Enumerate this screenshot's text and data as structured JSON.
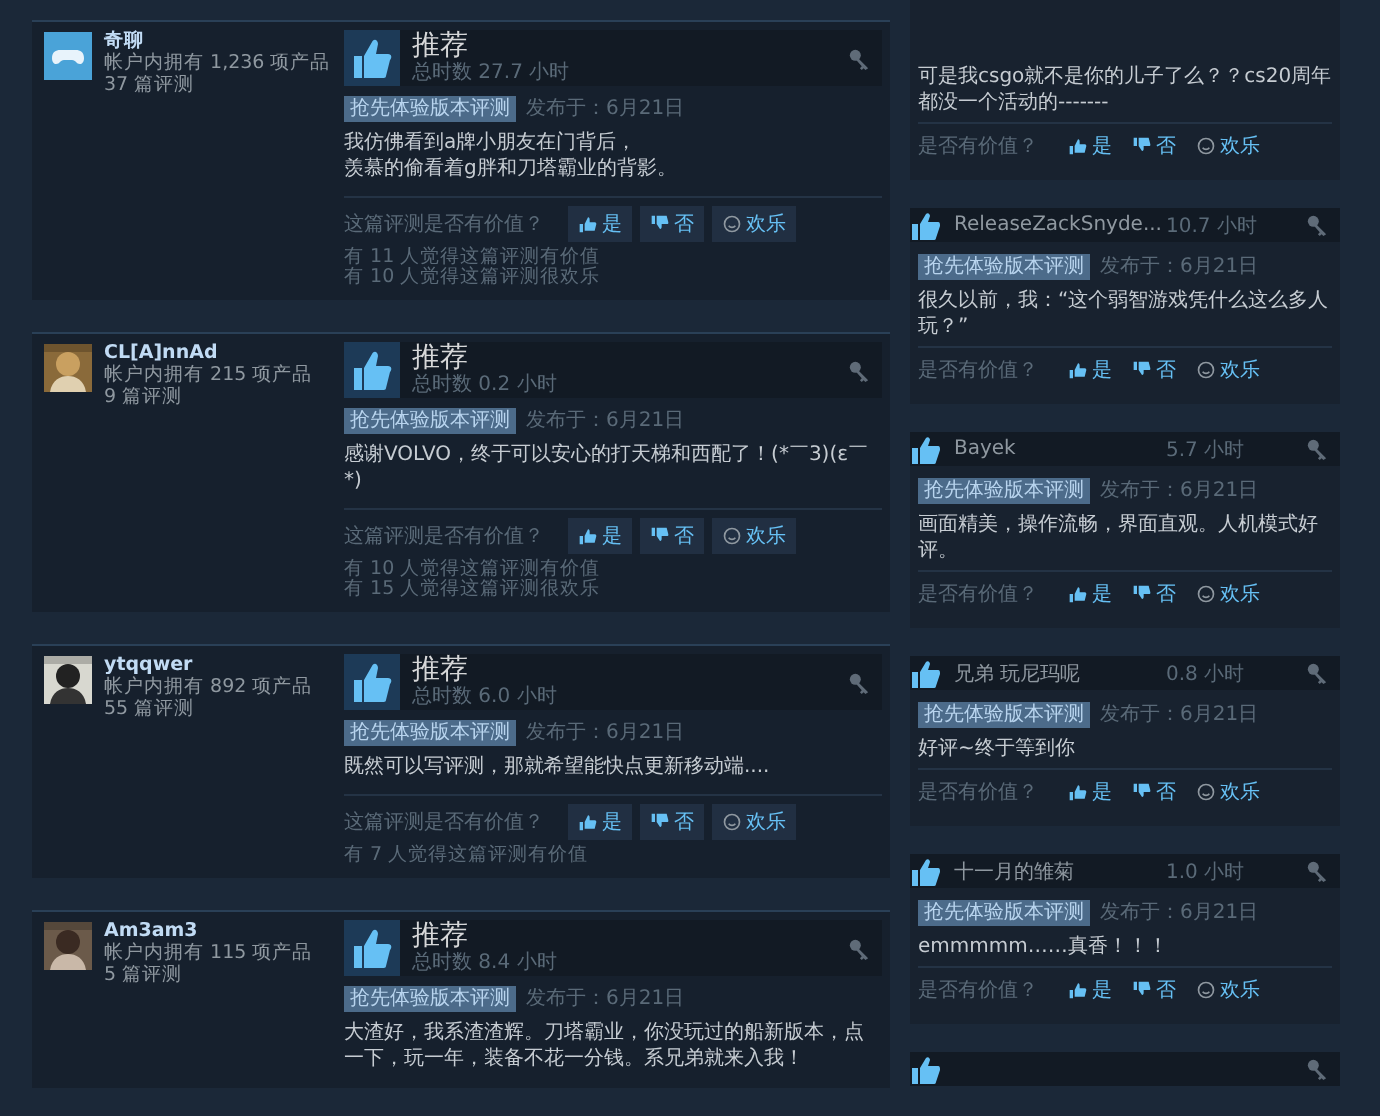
{
  "reviews": [
    {
      "author": "奇聊",
      "owned": "帐户内拥有 1,236 项产品",
      "review_count": "37 篇评测",
      "avatar": {
        "kind": "gamepad"
      },
      "verdict": "推荐",
      "hours": "总时数 27.7 小时",
      "tag": "抢先体验版本评测",
      "posted": "发布于：6月21日",
      "text": [
        "我仿佛看到a牌小朋友在门背后，",
        "羡慕的偷看着g胖和刀塔霸业的背影。"
      ],
      "question": "这篇评测是否有价值？",
      "buttons": [
        "是",
        "否",
        "欢乐"
      ],
      "counts": [
        "有 11 人觉得这篇评测有价值",
        "有 10 人觉得这篇评测很欢乐"
      ]
    },
    {
      "author": "CL[A]nnAd",
      "owned": "帐户内拥有 215 项产品",
      "review_count": "9 篇评测",
      "avatar": {
        "kind": "picture"
      },
      "verdict": "推荐",
      "hours": "总时数 0.2 小时",
      "tag": "抢先体验版本评测",
      "posted": "发布于：6月21日",
      "text": [
        "感谢VOLVO，终于可以安心的打天梯和西配了！(*￣3)(ε￣*)"
      ],
      "question": "这篇评测是否有价值？",
      "buttons": [
        "是",
        "否",
        "欢乐"
      ],
      "counts": [
        "有 10 人觉得这篇评测有价值",
        "有 15 人觉得这篇评测很欢乐"
      ]
    },
    {
      "author": "ytqqwer",
      "owned": "帐户内拥有 892 项产品",
      "review_count": "55 篇评测",
      "avatar": {
        "kind": "picture"
      },
      "verdict": "推荐",
      "hours": "总时数 6.0 小时",
      "tag": "抢先体验版本评测",
      "posted": "发布于：6月21日",
      "text": [
        "既然可以写评测，那就希望能快点更新移动端...."
      ],
      "question": "这篇评测是否有价值？",
      "buttons": [
        "是",
        "否",
        "欢乐"
      ],
      "counts": [
        "有 7 人觉得这篇评测有价值"
      ]
    },
    {
      "author": "Am3am3",
      "owned": "帐户内拥有 115 项产品",
      "review_count": "5 篇评测",
      "avatar": {
        "kind": "picture"
      },
      "verdict": "推荐",
      "hours": "总时数 8.4 小时",
      "tag": "抢先体验版本评测",
      "posted": "发布于：6月21日",
      "text": [
        "大渣好，我系渣渣辉。刀塔霸业，你没玩过的船新版本，点一下，玩一年，装备不花一分钱。系兄弟就来入我！"
      ]
    }
  ],
  "side_reviews": [
    {
      "kind": "continued",
      "text": "可是我csgo就不是你的儿子了么？？cs20周年都没一个活动的-------",
      "question": "是否有价值？",
      "buttons": [
        "是",
        "否",
        "欢乐"
      ]
    },
    {
      "kind": "full",
      "name": "ReleaseZackSnyde...",
      "hours": "10.7 小时",
      "tag": "抢先体验版本评测",
      "posted": "发布于：6月21日",
      "text": "很久以前，我：“这个弱智游戏凭什么这么多人玩？”",
      "question": "是否有价值？",
      "buttons": [
        "是",
        "否",
        "欢乐"
      ]
    },
    {
      "kind": "full",
      "name": "Bayek",
      "hours": "5.7 小时",
      "tag": "抢先体验版本评测",
      "posted": "发布于：6月21日",
      "text": "画面精美，操作流畅，界面直观。人机模式好评。",
      "question": "是否有价值？",
      "buttons": [
        "是",
        "否",
        "欢乐"
      ]
    },
    {
      "kind": "full",
      "name": "兄弟 玩尼玛呢",
      "hours": "0.8 小时",
      "tag": "抢先体验版本评测",
      "posted": "发布于：6月21日",
      "text": "好评~终于等到你",
      "question": "是否有价值？",
      "buttons": [
        "是",
        "否",
        "欢乐"
      ]
    },
    {
      "kind": "full",
      "name": "十一月的雏菊",
      "hours": "1.0 小时",
      "tag": "抢先体验版本评测",
      "posted": "发布于：6月21日",
      "text": "emmmmm……真香！！！",
      "question": "是否有价值？",
      "buttons": [
        "是",
        "否",
        "欢乐"
      ]
    },
    {
      "kind": "cut"
    }
  ]
}
